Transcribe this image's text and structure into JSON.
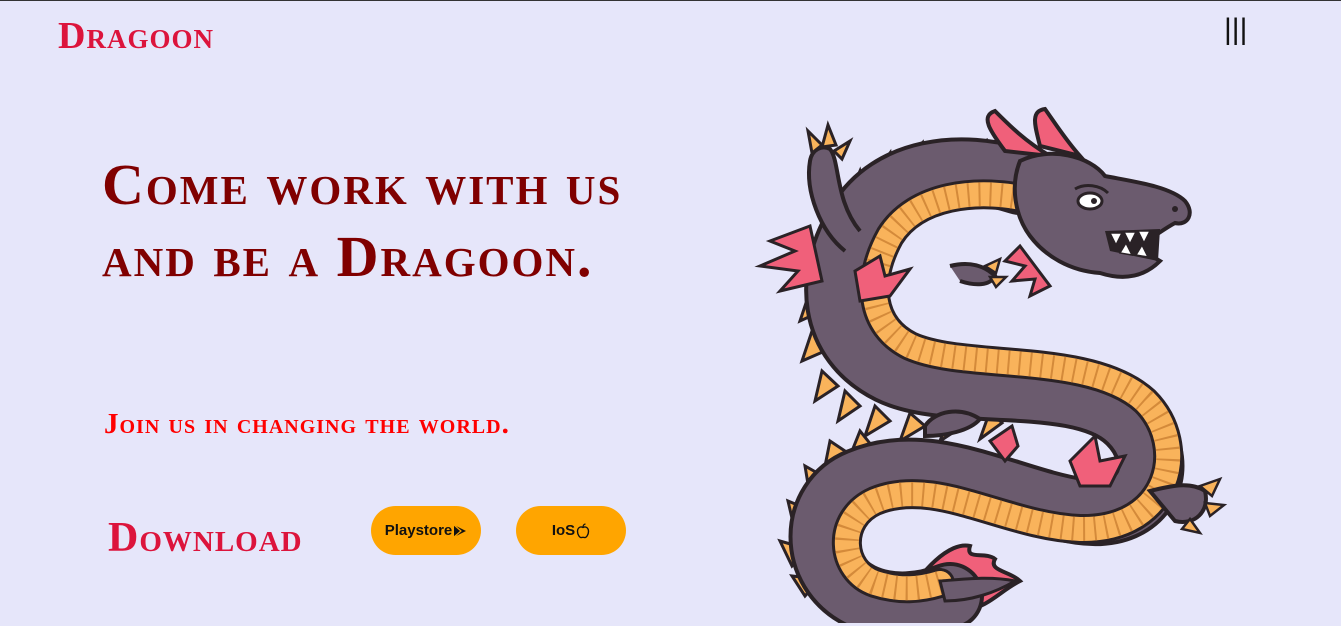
{
  "brand": {
    "name": "Dragoon"
  },
  "menu": {
    "icon": "menu-icon",
    "glyph": "|||"
  },
  "hero": {
    "headline": "Come work with us and be a Dragoon.",
    "subheadline": "Join us in changing the world."
  },
  "download": {
    "label": "Download",
    "buttons": [
      {
        "label": "Playstore",
        "icon": "play-store-icon"
      },
      {
        "label": "IoS",
        "icon": "apple-icon"
      }
    ]
  },
  "illustration": {
    "icon": "dragon-illustration"
  },
  "colors": {
    "background": "#e6e6fa",
    "brand": "#dc143c",
    "headline": "#800000",
    "subheadline": "#ff0000",
    "button": "#ffa500",
    "dragon_body": "#6b5b6e",
    "dragon_belly": "#f9b35b",
    "dragon_accent": "#f0607a"
  }
}
